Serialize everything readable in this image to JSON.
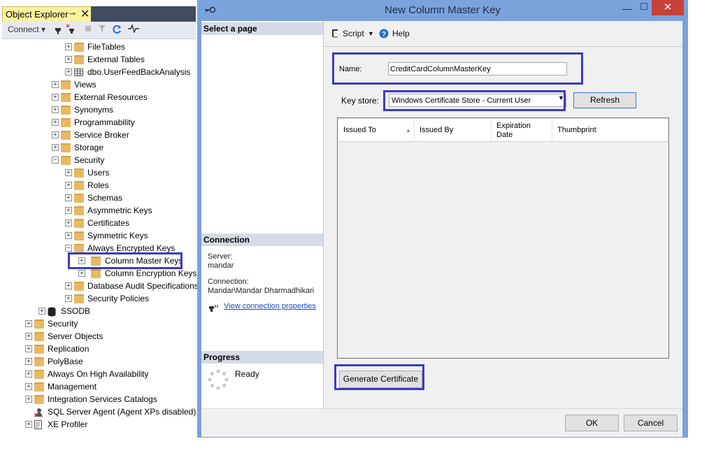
{
  "object_explorer": {
    "title": "Object Explorer",
    "pin_glyph": "⊸",
    "close_glyph": "✕",
    "toolbar": {
      "connect_label": "Connect ▾"
    },
    "tree": [
      {
        "label": "FileTables",
        "icon": "folder-icon",
        "depth": 4
      },
      {
        "label": "External Tables",
        "icon": "folder-icon",
        "depth": 4
      },
      {
        "label": "dbo.UserFeedBackAnalysis",
        "icon": "table-icon",
        "depth": 4
      },
      {
        "label": "Views",
        "icon": "folder-icon",
        "depth": 3
      },
      {
        "label": "External Resources",
        "icon": "folder-icon",
        "depth": 3
      },
      {
        "label": "Synonyms",
        "icon": "folder-icon",
        "depth": 3
      },
      {
        "label": "Programmability",
        "icon": "folder-icon",
        "depth": 3
      },
      {
        "label": "Service Broker",
        "icon": "folder-icon",
        "depth": 3
      },
      {
        "label": "Storage",
        "icon": "folder-icon",
        "depth": 3
      },
      {
        "label": "Security",
        "icon": "folder-icon",
        "depth": 3,
        "expanded": true
      },
      {
        "label": "Users",
        "icon": "folder-icon",
        "depth": 4
      },
      {
        "label": "Roles",
        "icon": "folder-icon",
        "depth": 4
      },
      {
        "label": "Schemas",
        "icon": "folder-icon",
        "depth": 4
      },
      {
        "label": "Asymmetric Keys",
        "icon": "folder-icon",
        "depth": 4
      },
      {
        "label": "Certificates",
        "icon": "folder-icon",
        "depth": 4
      },
      {
        "label": "Symmetric Keys",
        "icon": "folder-icon",
        "depth": 4
      },
      {
        "label": "Always Encrypted Keys",
        "icon": "folder-icon",
        "depth": 4,
        "expanded": true
      },
      {
        "label": "Column Master Keys",
        "icon": "folder-icon",
        "depth": 5,
        "selected": true
      },
      {
        "label": "Column Encryption Keys",
        "icon": "folder-icon",
        "depth": 5
      },
      {
        "label": "Database Audit Specifications",
        "icon": "folder-icon",
        "depth": 4
      },
      {
        "label": "Security Policies",
        "icon": "folder-icon",
        "depth": 4
      },
      {
        "label": "SSODB",
        "icon": "database-icon",
        "depth": 2
      },
      {
        "label": "Security",
        "icon": "folder-icon",
        "depth": 1
      },
      {
        "label": "Server Objects",
        "icon": "folder-icon",
        "depth": 1
      },
      {
        "label": "Replication",
        "icon": "folder-icon",
        "depth": 1
      },
      {
        "label": "PolyBase",
        "icon": "folder-icon",
        "depth": 1
      },
      {
        "label": "Always On High Availability",
        "icon": "folder-icon",
        "depth": 1
      },
      {
        "label": "Management",
        "icon": "folder-icon",
        "depth": 1
      },
      {
        "label": "Integration Services Catalogs",
        "icon": "folder-icon",
        "depth": 1
      },
      {
        "label": "SQL Server Agent (Agent XPs disabled)",
        "icon": "agent-icon",
        "depth": 1,
        "no_expander": true
      },
      {
        "label": "XE Profiler",
        "icon": "profiler-icon",
        "depth": 1
      }
    ]
  },
  "dialog": {
    "title": "New Column Master Key",
    "left_pane": {
      "select_page_header": "Select a page",
      "connection_header": "Connection",
      "server_label": "Server:",
      "server_value": "mandar",
      "connection_label": "Connection:",
      "connection_value": "Mandar\\Mandar Dharmadhikari",
      "view_connection_link": "View connection properties",
      "progress_header": "Progress",
      "progress_status": "Ready"
    },
    "toolbar": {
      "script_label": "Script",
      "help_label": "Help"
    },
    "name_label": "Name:",
    "name_value": "CreditCardColumnMasterKey",
    "key_store_label": "Key store:",
    "key_store_value": "Windows Certificate Store - Current User",
    "refresh_label": "Refresh",
    "grid_columns": [
      "Issued To",
      "Issued By",
      "Expiration Date",
      "Thumbprint"
    ],
    "generate_certificate_label": "Generate Certificate",
    "ok_label": "OK",
    "cancel_label": "Cancel"
  },
  "colors": {
    "highlight_box": "#3b3bbf",
    "dialog_frame": "#7aa3db",
    "oe_tab": "#fff29d",
    "close_red": "#c7413b"
  }
}
